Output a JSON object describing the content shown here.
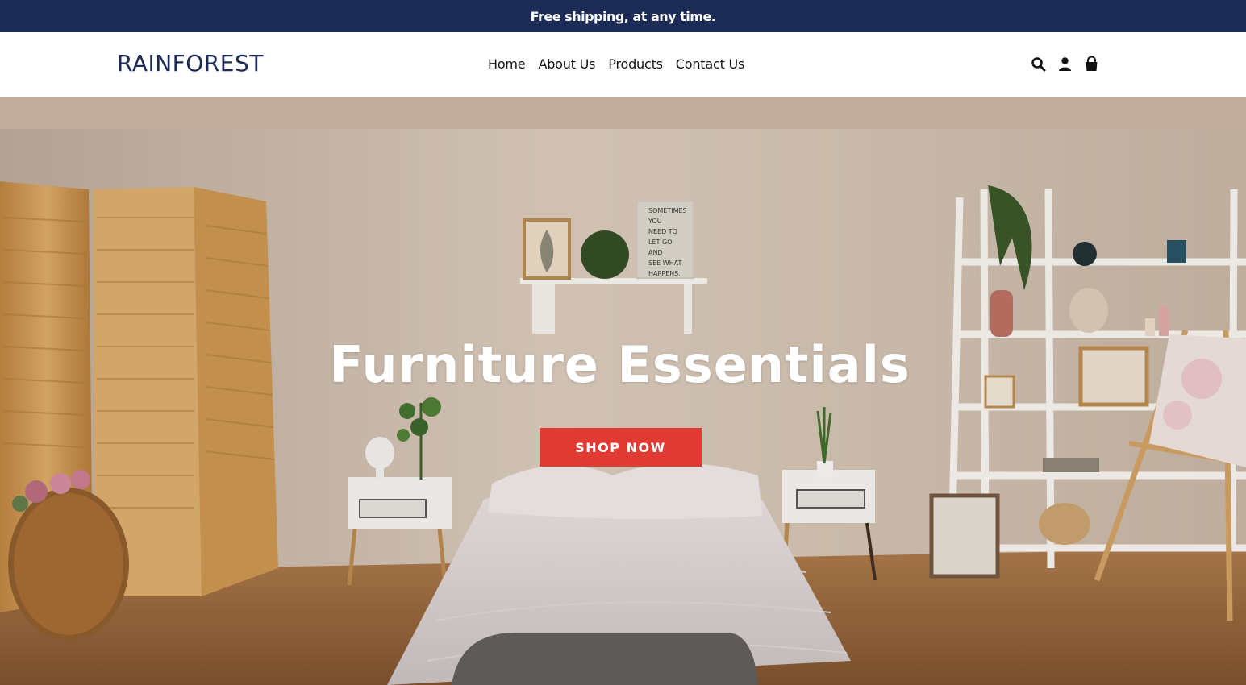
{
  "announcement": {
    "text": "Free shipping, at any time."
  },
  "header": {
    "logo": "RAINFOREST",
    "nav": [
      {
        "label": "Home"
      },
      {
        "label": "About Us"
      },
      {
        "label": "Products"
      },
      {
        "label": "Contact Us"
      }
    ],
    "icons": [
      "search-icon",
      "account-icon",
      "cart-icon"
    ]
  },
  "hero": {
    "title": "Furniture Essentials",
    "button_label": "SHOP NOW",
    "sign_lines": [
      "SOMETIMES",
      "YOU",
      "NEED TO",
      "LET GO",
      "AND",
      "SEE WHAT",
      "HAPPENS."
    ]
  },
  "colors": {
    "announcement_bg": "#1b2b55",
    "logo": "#1b2b55",
    "button_bg": "#e03a32",
    "button_text": "#ffffff"
  }
}
